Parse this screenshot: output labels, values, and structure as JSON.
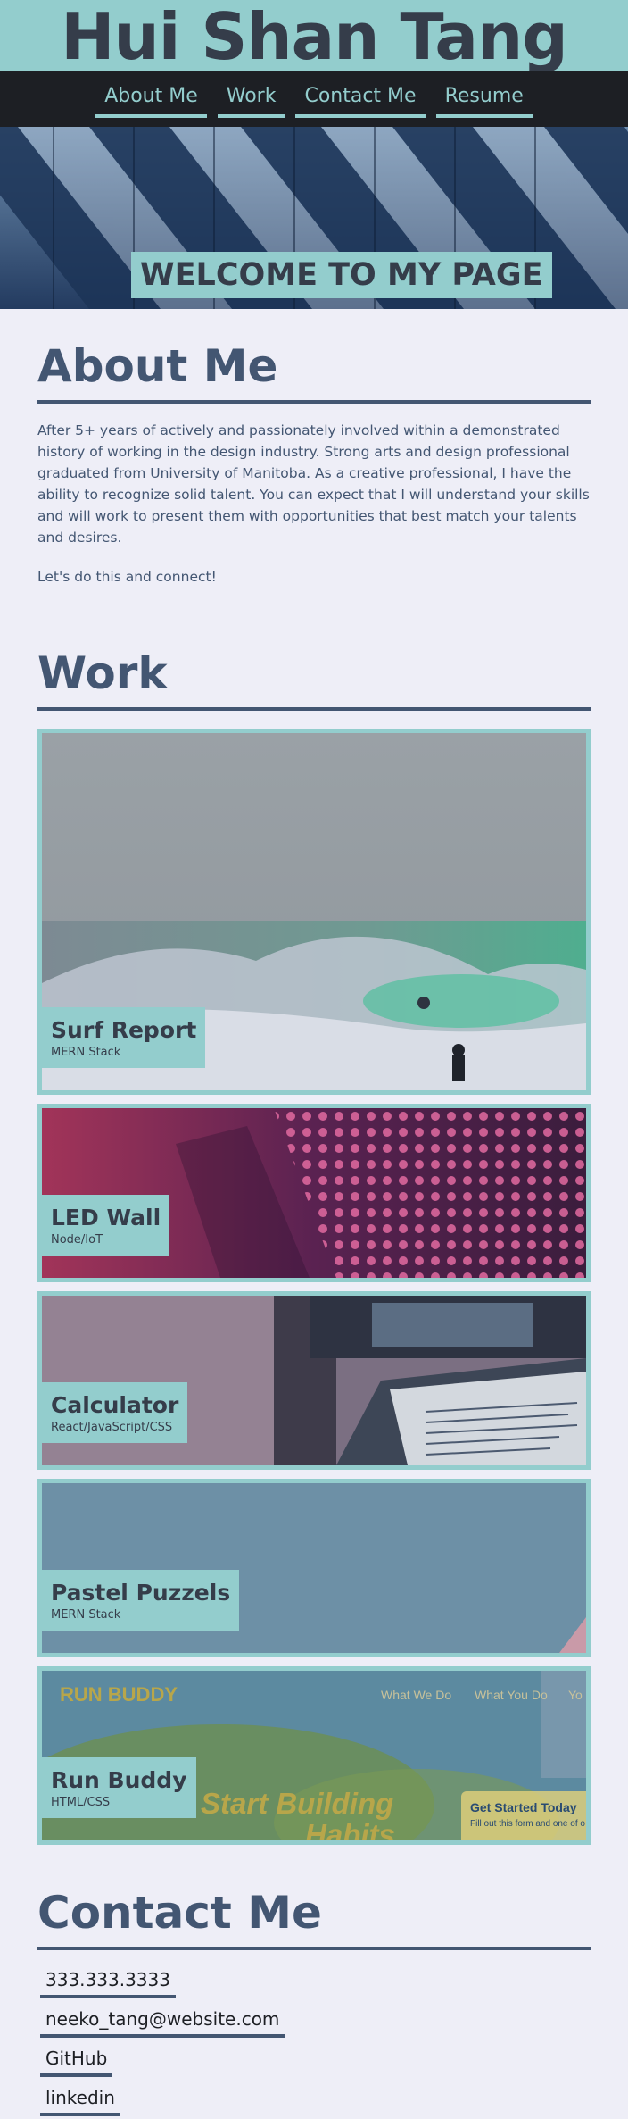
{
  "header": {
    "name": "Hui Shan Tang"
  },
  "nav": {
    "items": [
      "About Me",
      "Work",
      "Contact Me",
      "Resume"
    ]
  },
  "hero": {
    "title": "WELCOME TO MY PAGE"
  },
  "about": {
    "heading": "About Me",
    "paragraph": "After 5+ years of actively and passionately involved within a demonstrated history of working in the design industry. Strong arts and design professional graduated from University of Manitoba. As a creative professional, I have the ability to recognize solid talent. You can expect that I will understand your skills and will work to present them with opportunities that best match your talents and desires.",
    "closing": "Let's do this and connect!"
  },
  "work": {
    "heading": "Work",
    "projects": [
      {
        "title": "Surf Report",
        "tech": "MERN Stack"
      },
      {
        "title": "LED Wall",
        "tech": "Node/IoT"
      },
      {
        "title": "Calculator",
        "tech": "React/JavaScript/CSS"
      },
      {
        "title": "Pastel Puzzels",
        "tech": "MERN Stack"
      },
      {
        "title": "Run Buddy",
        "tech": "HTML/CSS",
        "screenshot_text": {
          "logo": "RUN BUDDY",
          "nav1": "What We Do",
          "nav2": "What You Do",
          "nav3": "Yo",
          "headline": "Start Building",
          "headline2": "Habits",
          "cta_title": "Get Started Today",
          "cta_sub": "Fill out this form and one of o"
        }
      }
    ]
  },
  "contact": {
    "heading": "Contact Me",
    "items": [
      "333.333.3333",
      "neeko_tang@website.com",
      "GitHub",
      "linkedin"
    ]
  },
  "colors": {
    "accent": "#93cdcd",
    "heading": "#435672",
    "dark": "#1d1f24",
    "background": "#eeeef7"
  }
}
